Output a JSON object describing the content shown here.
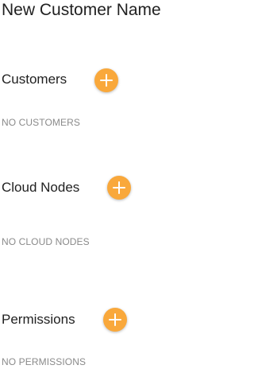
{
  "page": {
    "title": "New Customer Name"
  },
  "sections": [
    {
      "header": "Customers",
      "add_icon": "plus-icon",
      "empty_text": "NO CUSTOMERS"
    },
    {
      "header": "Cloud Nodes",
      "add_icon": "plus-icon",
      "empty_text": "NO CLOUD NODES"
    },
    {
      "header": "Permissions",
      "add_icon": "plus-icon",
      "empty_text": "NO PERMISSIONS"
    }
  ],
  "colors": {
    "accent": "#f9a83b",
    "text": "#212121",
    "muted": "#8a8a8a"
  }
}
